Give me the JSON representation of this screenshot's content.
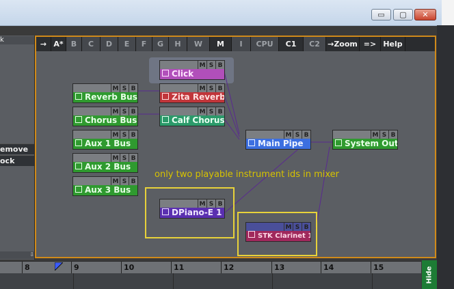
{
  "window": {
    "controls": {
      "minimize": "▭",
      "maximize": "▢",
      "close": "✕"
    }
  },
  "left_panel": {
    "top_label": "k",
    "remove_label": "emove",
    "lock_label": "ock",
    "scroll_label": "⇩"
  },
  "toolbar": {
    "buttons": [
      {
        "label": "→",
        "active": true
      },
      {
        "label": "A*",
        "active": true
      },
      {
        "label": "B",
        "active": false
      },
      {
        "label": "C",
        "active": false
      },
      {
        "label": "D",
        "active": false
      },
      {
        "label": "E",
        "active": false
      },
      {
        "label": "F",
        "active": false
      },
      {
        "label": "G",
        "active": false
      },
      {
        "label": "H",
        "active": false
      },
      {
        "label": "W",
        "active": false
      },
      {
        "label": "M",
        "active": true
      },
      {
        "label": "I",
        "active": false
      },
      {
        "label": "CPU",
        "active": false
      },
      {
        "label": "C1",
        "active": true
      },
      {
        "label": "C2",
        "active": false
      },
      {
        "label": "→Zoom",
        "active": true
      },
      {
        "label": "=>",
        "active": true
      },
      {
        "label": "Help",
        "active": true
      }
    ]
  },
  "strips": {
    "msb": {
      "m": "M",
      "s": "S",
      "b": "B"
    },
    "click": "Click",
    "reverb_bus": "Reverb Bus",
    "zita_reverb": "Zita Reverb",
    "chorus_bus": "Chorus Bus",
    "calf_chorus": "Calf Chorus",
    "aux1": "Aux 1 Bus",
    "aux2": "Aux 2 Bus",
    "aux3": "Aux 3 Bus",
    "main_pipe": "Main Pipe",
    "system_out": "System Out",
    "dpiano": "DPiano-E 1",
    "stk_clarinet": "STK Clarinet 1"
  },
  "annotation": "only two playable instrument ids in mixer",
  "ruler": {
    "ticks": [
      "8",
      "9",
      "10",
      "11",
      "12",
      "13",
      "14",
      "15"
    ]
  },
  "hide_button": "Hide",
  "colors": {
    "frame": "#d08a1a",
    "annotation": "#d8c300"
  }
}
